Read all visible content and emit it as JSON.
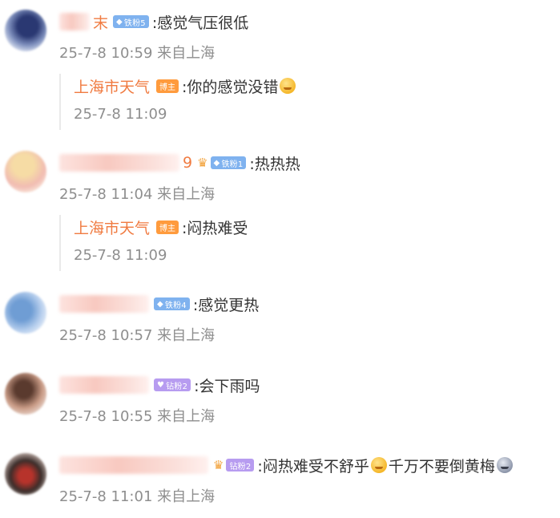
{
  "comments": [
    {
      "username_tail": "末",
      "badge": "铁粉5",
      "text": ":感觉气压很低",
      "meta": "25-7-8 10:59 来自上海",
      "avatar_colors": [
        "#1d2a5a",
        "#6d7fae",
        "#dfe6f5"
      ],
      "reply": {
        "name": "上海市天气",
        "host_badge": "博主",
        "text": ":你的感觉没错",
        "emoji": "thinking-emoji",
        "meta": "25-7-8 11:09"
      }
    },
    {
      "username_tail": "9",
      "badge": "铁粉1",
      "text": ":热热热",
      "meta": "25-7-8 11:04 来自上海",
      "avatar_colors": [
        "#f4d9a2",
        "#f2b8b0",
        "#fbeee2"
      ],
      "reply": {
        "name": "上海市天气",
        "host_badge": "博主",
        "text": ":闷热难受",
        "meta": "25-7-8 11:09"
      }
    },
    {
      "badge": "铁粉4",
      "text": ":感觉更热",
      "meta": "25-7-8 10:57 来自上海",
      "avatar_colors": [
        "#7fa9d9",
        "#c5d9f0",
        "#eef3fa"
      ]
    },
    {
      "badge": "钻粉2",
      "text": ":会下雨吗",
      "meta": "25-7-8 10:55 来自上海",
      "avatar_colors": [
        "#5c3a2e",
        "#c99b86",
        "#f1e3dc"
      ]
    },
    {
      "badge": "钻粉2",
      "text": ":闷热难受不舒乎",
      "text2": "千万不要倒黄梅",
      "emoji1": "sweat-smile-emoji",
      "emoji2": "scared-emoji",
      "meta": "25-7-8 11:01 来自上海",
      "avatar_colors": [
        "#2b2b2b",
        "#b7332b",
        "#e8d6cf"
      ]
    }
  ]
}
